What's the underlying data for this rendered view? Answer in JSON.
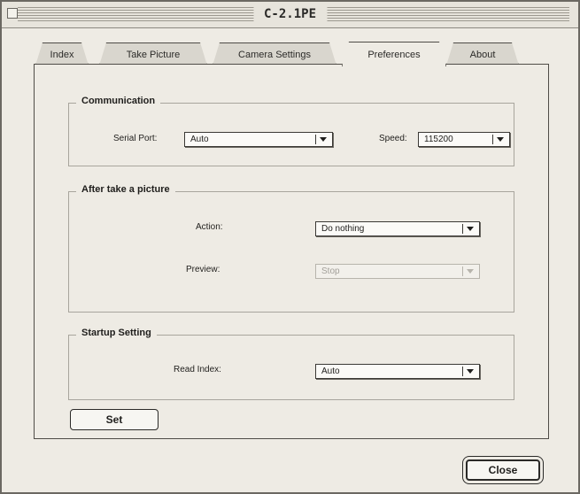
{
  "window": {
    "title": "C-2.1PE"
  },
  "tabs": [
    {
      "label": "Index"
    },
    {
      "label": "Take Picture"
    },
    {
      "label": "Camera Settings"
    },
    {
      "label": "Preferences",
      "active": true
    },
    {
      "label": "About"
    }
  ],
  "communication": {
    "title": "Communication",
    "serial_port": {
      "label": "Serial Port:",
      "value": "Auto"
    },
    "speed": {
      "label": "Speed:",
      "value": "115200"
    }
  },
  "after_picture": {
    "title": "After take a picture",
    "action": {
      "label": "Action:",
      "value": "Do nothing"
    },
    "preview": {
      "label": "Preview:",
      "value": "Stop",
      "disabled": true
    }
  },
  "startup": {
    "title": "Startup Setting",
    "read_index": {
      "label": "Read Index:",
      "value": "Auto"
    }
  },
  "buttons": {
    "set": "Set",
    "close": "Close"
  },
  "icons": {
    "dropdown": "chevron-down-icon",
    "close_box": "close-box-icon"
  },
  "colors": {
    "window_bg": "#eeebe4",
    "border": "#4f4c47"
  }
}
